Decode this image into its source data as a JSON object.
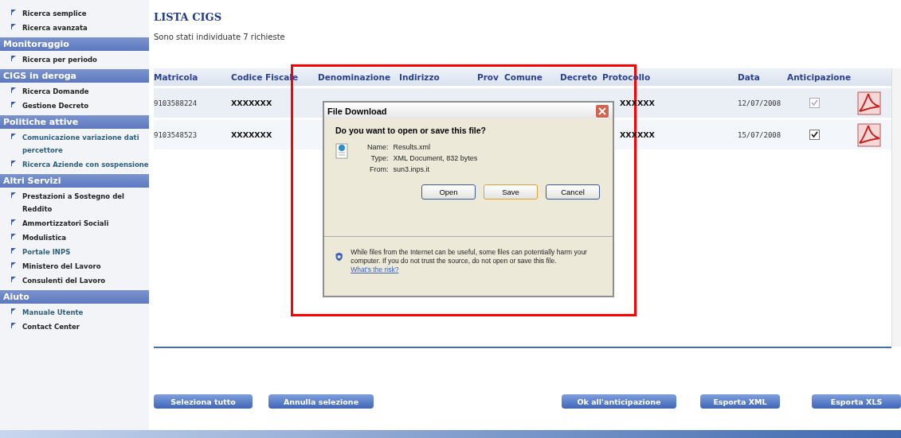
{
  "sidebar": {
    "sections": [
      {
        "items": [
          {
            "label": "Ricerca semplice",
            "visited": false
          },
          {
            "label": "Ricerca avanzata",
            "visited": false
          }
        ]
      },
      {
        "title": "Monitoraggio",
        "items": [
          {
            "label": "Ricerca per periodo",
            "visited": false
          }
        ]
      },
      {
        "title": "CIGS in deroga",
        "items": [
          {
            "label": "Ricerca Domande",
            "visited": false
          },
          {
            "label": "Gestione Decreto",
            "visited": false
          }
        ]
      },
      {
        "title": "Politiche attive",
        "items": [
          {
            "label": "Comunicazione variazione dati percettore",
            "visited": true
          },
          {
            "label": "Ricerca Aziende con sospensione",
            "visited": true
          }
        ]
      },
      {
        "title": "Altri Servizi",
        "items": [
          {
            "label": "Prestazioni a Sostegno del Reddito",
            "visited": false
          },
          {
            "label": "Ammortizzatori Sociali",
            "visited": false
          },
          {
            "label": "Modulistica",
            "visited": false
          },
          {
            "label": "Portale INPS",
            "visited": true
          },
          {
            "label": "Ministero del Lavoro",
            "visited": false
          },
          {
            "label": "Consulenti del Lavoro",
            "visited": false
          }
        ]
      },
      {
        "title": "Aiuto",
        "items": [
          {
            "label": "Manuale Utente",
            "visited": true
          },
          {
            "label": "Contact Center",
            "visited": false
          }
        ]
      }
    ]
  },
  "page": {
    "title": "LISTA CIGS",
    "summary": "Sono stati individuate 7 richieste"
  },
  "table": {
    "columns": [
      "Matricola",
      "Codice Fiscale",
      "Denominazione",
      "Indirizzo",
      "Prov",
      "Comune",
      "Decreto",
      "Protocollo",
      "Data",
      "Anticipazione"
    ],
    "rows": [
      {
        "matricola": "9103588224",
        "codice_fiscale": "XXXXXXX",
        "protocollo": "XXXXXX",
        "data": "12/07/2008",
        "anticipazione": {
          "checked": true,
          "disabled": true
        }
      },
      {
        "matricola": "9103548523",
        "codice_fiscale": "XXXXXXX",
        "protocollo": "XXXXXX",
        "data": "15/07/2008",
        "anticipazione": {
          "checked": true,
          "disabled": false
        }
      }
    ]
  },
  "dialog": {
    "title": "File Download",
    "question": "Do you want to open or save this file?",
    "fields": [
      {
        "label": "Name:",
        "value": "Results.xml"
      },
      {
        "label": "Type:",
        "value": "XML Document, 832 bytes"
      },
      {
        "label": "From:",
        "value": "sun3.inps.it"
      }
    ],
    "buttons": [
      {
        "label": "Open",
        "selected": false
      },
      {
        "label": "Save",
        "selected": true
      },
      {
        "label": "Cancel",
        "selected": false
      }
    ],
    "warning": "While files from the Internet can be useful, some files can potentially harm your computer. If you do not trust the source, do not open or save this file.",
    "risk_link": "What's the risk?"
  },
  "actions": [
    "Seleziona tutto",
    "Annulla selezione",
    "Ok all'anticipazione",
    "Esporta XML",
    "Esporta XLS"
  ]
}
